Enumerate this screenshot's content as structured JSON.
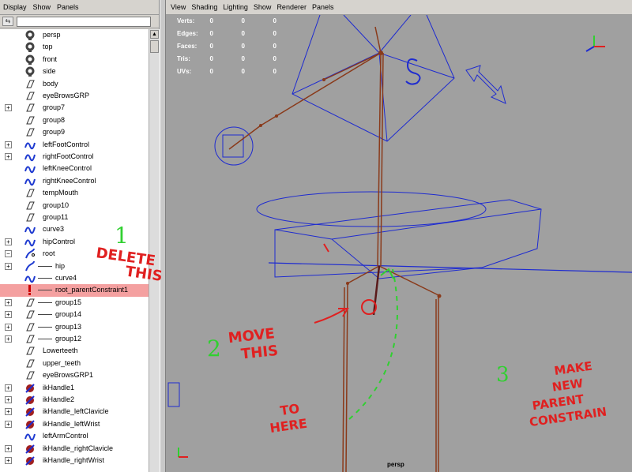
{
  "outliner": {
    "menu": [
      "Display",
      "Show",
      "Panels"
    ],
    "items": [
      {
        "label": "persp",
        "icon": "camera-icon",
        "expand": ""
      },
      {
        "label": "top",
        "icon": "camera-icon",
        "expand": ""
      },
      {
        "label": "front",
        "icon": "camera-icon",
        "expand": ""
      },
      {
        "label": "side",
        "icon": "camera-icon",
        "expand": ""
      },
      {
        "label": "body",
        "icon": "mesh-icon",
        "expand": ""
      },
      {
        "label": "eyeBrowsGRP",
        "icon": "mesh-icon",
        "expand": ""
      },
      {
        "label": "group7",
        "icon": "mesh-icon",
        "expand": "+"
      },
      {
        "label": "group8",
        "icon": "mesh-icon",
        "expand": ""
      },
      {
        "label": "group9",
        "icon": "mesh-icon",
        "expand": ""
      },
      {
        "label": "leftFootControl",
        "icon": "curve-icon",
        "expand": "+"
      },
      {
        "label": "rightFootControl",
        "icon": "curve-icon",
        "expand": "+"
      },
      {
        "label": "leftKneeControl",
        "icon": "curve-icon",
        "expand": ""
      },
      {
        "label": "rightKneeControl",
        "icon": "curve-icon",
        "expand": ""
      },
      {
        "label": "tempMouth",
        "icon": "mesh-icon",
        "expand": ""
      },
      {
        "label": "group10",
        "icon": "mesh-icon",
        "expand": ""
      },
      {
        "label": "group11",
        "icon": "mesh-icon",
        "expand": ""
      },
      {
        "label": "curve3",
        "icon": "curve-icon",
        "expand": ""
      },
      {
        "label": "hipControl",
        "icon": "curve-icon",
        "expand": "+"
      },
      {
        "label": "root",
        "icon": "joint-icon",
        "expand": "−"
      },
      {
        "label": "hip",
        "icon": "joint-child-icon",
        "expand": "+"
      },
      {
        "label": "curve4",
        "icon": "curve-child-icon",
        "expand": ""
      },
      {
        "label": "root_parentConstraint1",
        "icon": "constraint-icon",
        "expand": "",
        "selected": true
      },
      {
        "label": "group15",
        "icon": "mesh-child-icon",
        "expand": "+"
      },
      {
        "label": "group14",
        "icon": "mesh-child-icon",
        "expand": "+"
      },
      {
        "label": "group13",
        "icon": "mesh-child-icon",
        "expand": "+"
      },
      {
        "label": "group12",
        "icon": "mesh-child-icon",
        "expand": "+"
      },
      {
        "label": "Lowerteeth",
        "icon": "mesh-icon",
        "expand": ""
      },
      {
        "label": "upper_teeth",
        "icon": "mesh-icon",
        "expand": ""
      },
      {
        "label": "eyeBrowsGRP1",
        "icon": "mesh-icon",
        "expand": ""
      },
      {
        "label": "ikHandle1",
        "icon": "ik-icon",
        "expand": "+"
      },
      {
        "label": "ikHandle2",
        "icon": "ik-icon",
        "expand": "+"
      },
      {
        "label": "ikHandle_leftClavicle",
        "icon": "ik-icon",
        "expand": "+"
      },
      {
        "label": "ikHandle_leftWrist",
        "icon": "ik-icon",
        "expand": "+"
      },
      {
        "label": "leftArmControl",
        "icon": "curve-icon",
        "expand": ""
      },
      {
        "label": "ikHandle_rightClavicle",
        "icon": "ik-icon",
        "expand": "+"
      },
      {
        "label": "ikHandle_rightWrist",
        "icon": "ik-icon",
        "expand": "+"
      }
    ]
  },
  "viewport": {
    "menu": [
      "View",
      "Shading",
      "Lighting",
      "Show",
      "Renderer",
      "Panels"
    ],
    "camera": "persp",
    "hud": [
      {
        "label": "Verts:",
        "values": [
          "0",
          "0",
          "0"
        ]
      },
      {
        "label": "Edges:",
        "values": [
          "0",
          "0",
          "0"
        ]
      },
      {
        "label": "Faces:",
        "values": [
          "0",
          "0",
          "0"
        ]
      },
      {
        "label": "Tris:",
        "values": [
          "0",
          "0",
          "0"
        ]
      },
      {
        "label": "UVs:",
        "values": [
          "0",
          "0",
          "0"
        ]
      }
    ],
    "annotations": {
      "step1_number": "1",
      "step1_text": [
        "DELETE",
        "THIS"
      ],
      "step2_number": "2",
      "step2_text": [
        "MOVE",
        "THIS"
      ],
      "to_here": [
        "TO",
        "HERE"
      ],
      "step3_number": "3",
      "step3_text": [
        "MAKE",
        "NEW",
        "PARENT",
        "CONSTRAIN"
      ]
    },
    "colors": {
      "background": "#a0a0a0",
      "wire": "#1e2bd0",
      "joint": "#8a3a1a",
      "annotation_red": "#e02020",
      "annotation_green": "#30d030"
    }
  }
}
